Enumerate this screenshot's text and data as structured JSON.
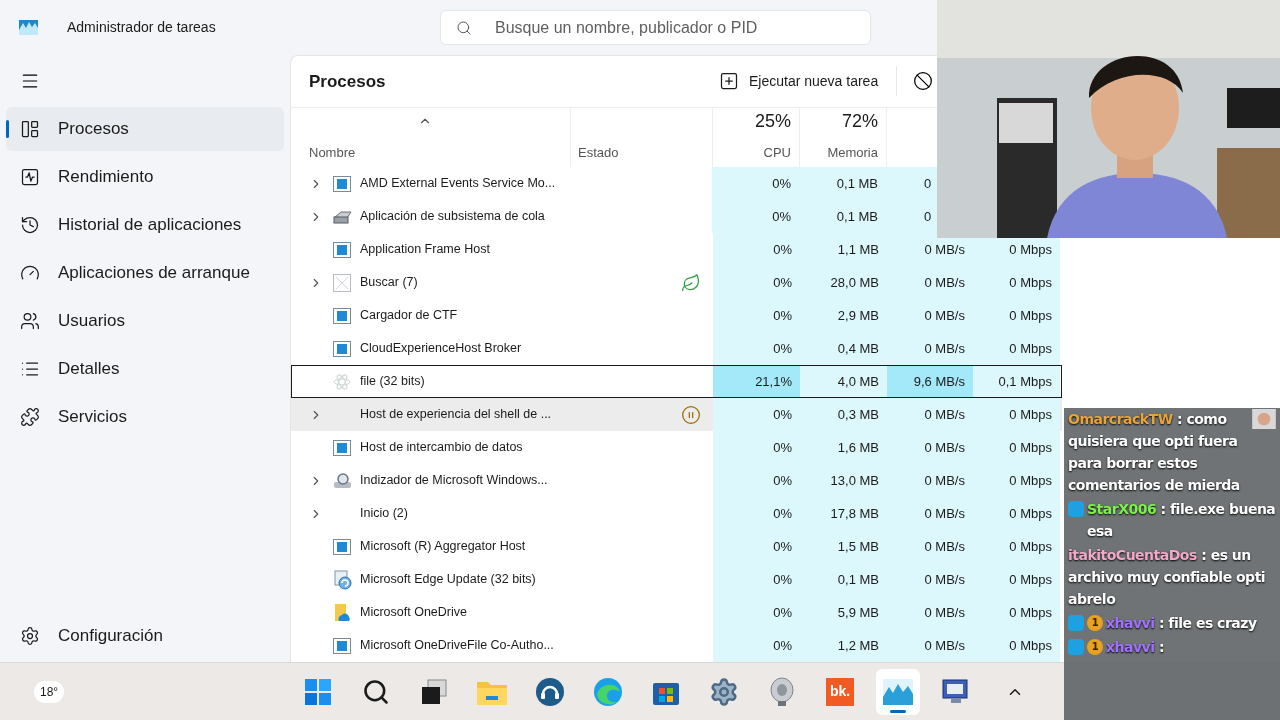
{
  "window": {
    "title": "Administrador de tareas"
  },
  "search": {
    "placeholder": "Busque un nombre, publicador o PID"
  },
  "sidebar": {
    "items": [
      {
        "kind": "processes",
        "label": "Procesos",
        "selected": true
      },
      {
        "kind": "performance",
        "label": "Rendimiento",
        "selected": false
      },
      {
        "kind": "history",
        "label": "Historial de aplicaciones",
        "selected": false
      },
      {
        "kind": "startup",
        "label": "Aplicaciones de arranque",
        "selected": false
      },
      {
        "kind": "users",
        "label": "Usuarios",
        "selected": false
      },
      {
        "kind": "details",
        "label": "Detalles",
        "selected": false
      },
      {
        "kind": "services",
        "label": "Servicios",
        "selected": false
      }
    ],
    "settings": {
      "kind": "settings",
      "label": "Configuración",
      "selected": false
    }
  },
  "panel": {
    "title": "Procesos",
    "run_task": "Ejecutar nueva tarea"
  },
  "table": {
    "columns": [
      {
        "label": "Nombre"
      },
      {
        "label": "Estado"
      },
      {
        "usage": "25%",
        "label": "CPU"
      },
      {
        "usage": "72%",
        "label": "Memoria"
      }
    ],
    "rows": [
      {
        "name": "AMD External Events Service Mo...",
        "expandable": true,
        "kind": "app",
        "eco": false,
        "paused": false,
        "cpu": "0%",
        "memory": "0,1 MB",
        "disk": "0",
        "selected": false,
        "hovered": false,
        "cpu_hot": false,
        "disk_hot": false
      },
      {
        "name": "Aplicación de subsistema de cola",
        "expandable": true,
        "kind": "printer",
        "eco": false,
        "paused": false,
        "cpu": "0%",
        "memory": "0,1 MB",
        "disk": "0",
        "selected": false,
        "hovered": false,
        "cpu_hot": false,
        "disk_hot": false
      },
      {
        "name": "Application Frame Host",
        "expandable": false,
        "kind": "app",
        "eco": false,
        "paused": false,
        "cpu": "0%",
        "memory": "1,1 MB",
        "disk": "0 MB/s",
        "network": "0 Mbps",
        "selected": false,
        "hovered": false,
        "cpu_hot": false,
        "disk_hot": false
      },
      {
        "name": "Buscar (7)",
        "expandable": true,
        "kind": "blank",
        "eco": true,
        "paused": false,
        "cpu": "0%",
        "memory": "28,0 MB",
        "disk": "0 MB/s",
        "network": "0 Mbps",
        "selected": false,
        "hovered": false,
        "cpu_hot": false,
        "disk_hot": false
      },
      {
        "name": "Cargador de CTF",
        "expandable": false,
        "kind": "app",
        "eco": false,
        "paused": false,
        "cpu": "0%",
        "memory": "2,9 MB",
        "disk": "0 MB/s",
        "network": "0 Mbps",
        "selected": false,
        "hovered": false,
        "cpu_hot": false,
        "disk_hot": false
      },
      {
        "name": "CloudExperienceHost Broker",
        "expandable": false,
        "kind": "app",
        "eco": false,
        "paused": false,
        "cpu": "0%",
        "memory": "0,4 MB",
        "disk": "0 MB/s",
        "network": "0 Mbps",
        "selected": false,
        "hovered": false,
        "cpu_hot": false,
        "disk_hot": false
      },
      {
        "name": "file (32 bits)",
        "expandable": false,
        "kind": "atom",
        "eco": false,
        "paused": false,
        "cpu": "21,1%",
        "memory": "4,0 MB",
        "disk": "9,6 MB/s",
        "network": "0,1 Mbps",
        "selected": true,
        "hovered": false,
        "cpu_hot": true,
        "disk_hot": true
      },
      {
        "name": "Host de experiencia del shell de ...",
        "expandable": true,
        "kind": "plain",
        "eco": false,
        "paused": true,
        "cpu": "0%",
        "memory": "0,3 MB",
        "disk": "0 MB/s",
        "network": "0 Mbps",
        "selected": false,
        "hovered": true,
        "cpu_hot": false,
        "disk_hot": false
      },
      {
        "name": "Host de intercambio de datos",
        "expandable": false,
        "kind": "app",
        "eco": false,
        "paused": false,
        "cpu": "0%",
        "memory": "1,6 MB",
        "disk": "0 MB/s",
        "network": "0 Mbps",
        "selected": false,
        "hovered": false,
        "cpu_hot": false,
        "disk_hot": false
      },
      {
        "name": "Indizador de Microsoft Windows...",
        "expandable": true,
        "kind": "indexer",
        "eco": false,
        "paused": false,
        "cpu": "0%",
        "memory": "13,0 MB",
        "disk": "0 MB/s",
        "network": "0 Mbps",
        "selected": false,
        "hovered": false,
        "cpu_hot": false,
        "disk_hot": false
      },
      {
        "name": "Inicio (2)",
        "expandable": true,
        "kind": "plain",
        "eco": false,
        "paused": false,
        "cpu": "0%",
        "memory": "17,8 MB",
        "disk": "0 MB/s",
        "network": "0 Mbps",
        "selected": false,
        "hovered": false,
        "cpu_hot": false,
        "disk_hot": false
      },
      {
        "name": "Microsoft (R) Aggregator Host",
        "expandable": false,
        "kind": "app",
        "eco": false,
        "paused": false,
        "cpu": "0%",
        "memory": "1,5 MB",
        "disk": "0 MB/s",
        "network": "0 Mbps",
        "selected": false,
        "hovered": false,
        "cpu_hot": false,
        "disk_hot": false
      },
      {
        "name": "Microsoft Edge Update (32 bits)",
        "expandable": false,
        "kind": "update",
        "eco": false,
        "paused": false,
        "cpu": "0%",
        "memory": "0,1 MB",
        "disk": "0 MB/s",
        "network": "0 Mbps",
        "selected": false,
        "hovered": false,
        "cpu_hot": false,
        "disk_hot": false
      },
      {
        "name": "Microsoft OneDrive",
        "expandable": false,
        "kind": "cloud",
        "eco": false,
        "paused": false,
        "cpu": "0%",
        "memory": "5,9 MB",
        "disk": "0 MB/s",
        "network": "0 Mbps",
        "selected": false,
        "hovered": false,
        "cpu_hot": false,
        "disk_hot": false
      },
      {
        "name": "Microsoft OneDriveFile Co-Autho...",
        "expandable": false,
        "kind": "app",
        "eco": false,
        "paused": false,
        "cpu": "0%",
        "memory": "1,2 MB",
        "disk": "0 MB/s",
        "network": "0 Mbps",
        "selected": false,
        "hovered": false,
        "cpu_hot": false,
        "disk_hot": false
      }
    ]
  },
  "chat": [
    {
      "user": "OmarcrackTW",
      "color": "#e8a33a",
      "mod_badge": false,
      "separator": ":",
      "text": "como quisiera que opti fuera para borrar estos comentarios de mierda",
      "emote": true
    },
    {
      "user": "StarX006",
      "color": "#7cf24a",
      "mod_badge": true,
      "separator": ":",
      "text": "file.exe buena esa",
      "emote": false
    },
    {
      "user": "itakitoCuentaDos",
      "color": "#f2a9c9",
      "mod_badge": false,
      "separator": ":",
      "text": "es un archivo muy confiable opti abrelo",
      "emote": false
    },
    {
      "user": "xhavvi",
      "color": "#a070ff",
      "mod_badge": true,
      "tier": "1",
      "separator": ":",
      "text": "file es crazy",
      "emote": false
    },
    {
      "user": "xhavvi",
      "color": "#a070ff",
      "mod_badge": true,
      "tier": "1",
      "separator": ":",
      "emote": false
    }
  ],
  "taskbar": {
    "weather": "18°",
    "apps": [
      {
        "kind": "start",
        "active": false
      },
      {
        "kind": "search",
        "active": false
      },
      {
        "kind": "taskview",
        "active": false
      },
      {
        "kind": "folder",
        "active": false
      },
      {
        "kind": "headset",
        "active": false
      },
      {
        "kind": "edge",
        "active": false
      },
      {
        "kind": "store",
        "active": false
      },
      {
        "kind": "gear",
        "active": false
      },
      {
        "kind": "speaker",
        "active": false
      },
      {
        "kind": "text",
        "label": "bk.",
        "active": false
      },
      {
        "kind": "taskmgr",
        "active": true
      },
      {
        "kind": "monitor",
        "active": false
      }
    ]
  }
}
